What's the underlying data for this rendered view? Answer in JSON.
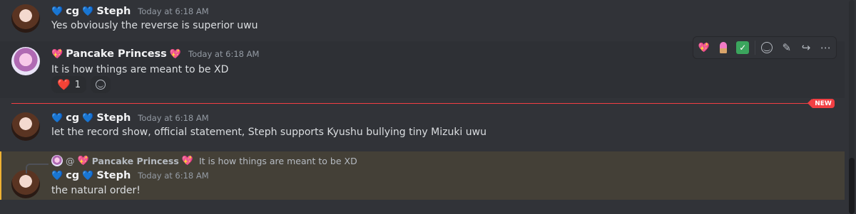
{
  "messages": [
    {
      "author": "cg",
      "author2": "Steph",
      "timestamp": "Today at 6:18 AM",
      "text": "Yes obviously the reverse is superior uwu"
    },
    {
      "author": "Pancake Princess",
      "timestamp": "Today at 6:18 AM",
      "text": "It is how things are meant to be XD",
      "reaction_count": "1"
    },
    {
      "author": "cg",
      "author2": "Steph",
      "timestamp": "Today at 6:18 AM",
      "text": "let the record show, official statement, Steph supports Kyushu bullying tiny Mizuki uwu"
    },
    {
      "author": "cg",
      "author2": "Steph",
      "timestamp": "Today at 6:18 AM",
      "text": "the natural order!",
      "reply": {
        "at": "@",
        "author": "Pancake Princess",
        "text": "It is how things are meant to be XD"
      }
    }
  ],
  "new_badge": "NEW",
  "icons": {
    "blue_heart": "💙",
    "pink_heart": "💖",
    "red_heart": "❤️",
    "check": "✓",
    "pencil": "✎",
    "forward": "↪",
    "more": "⋯"
  },
  "colors": {
    "background": "#313338",
    "mention_highlight": "#444037",
    "new_divider": "#f23f43",
    "username": "#f2f3f5"
  }
}
